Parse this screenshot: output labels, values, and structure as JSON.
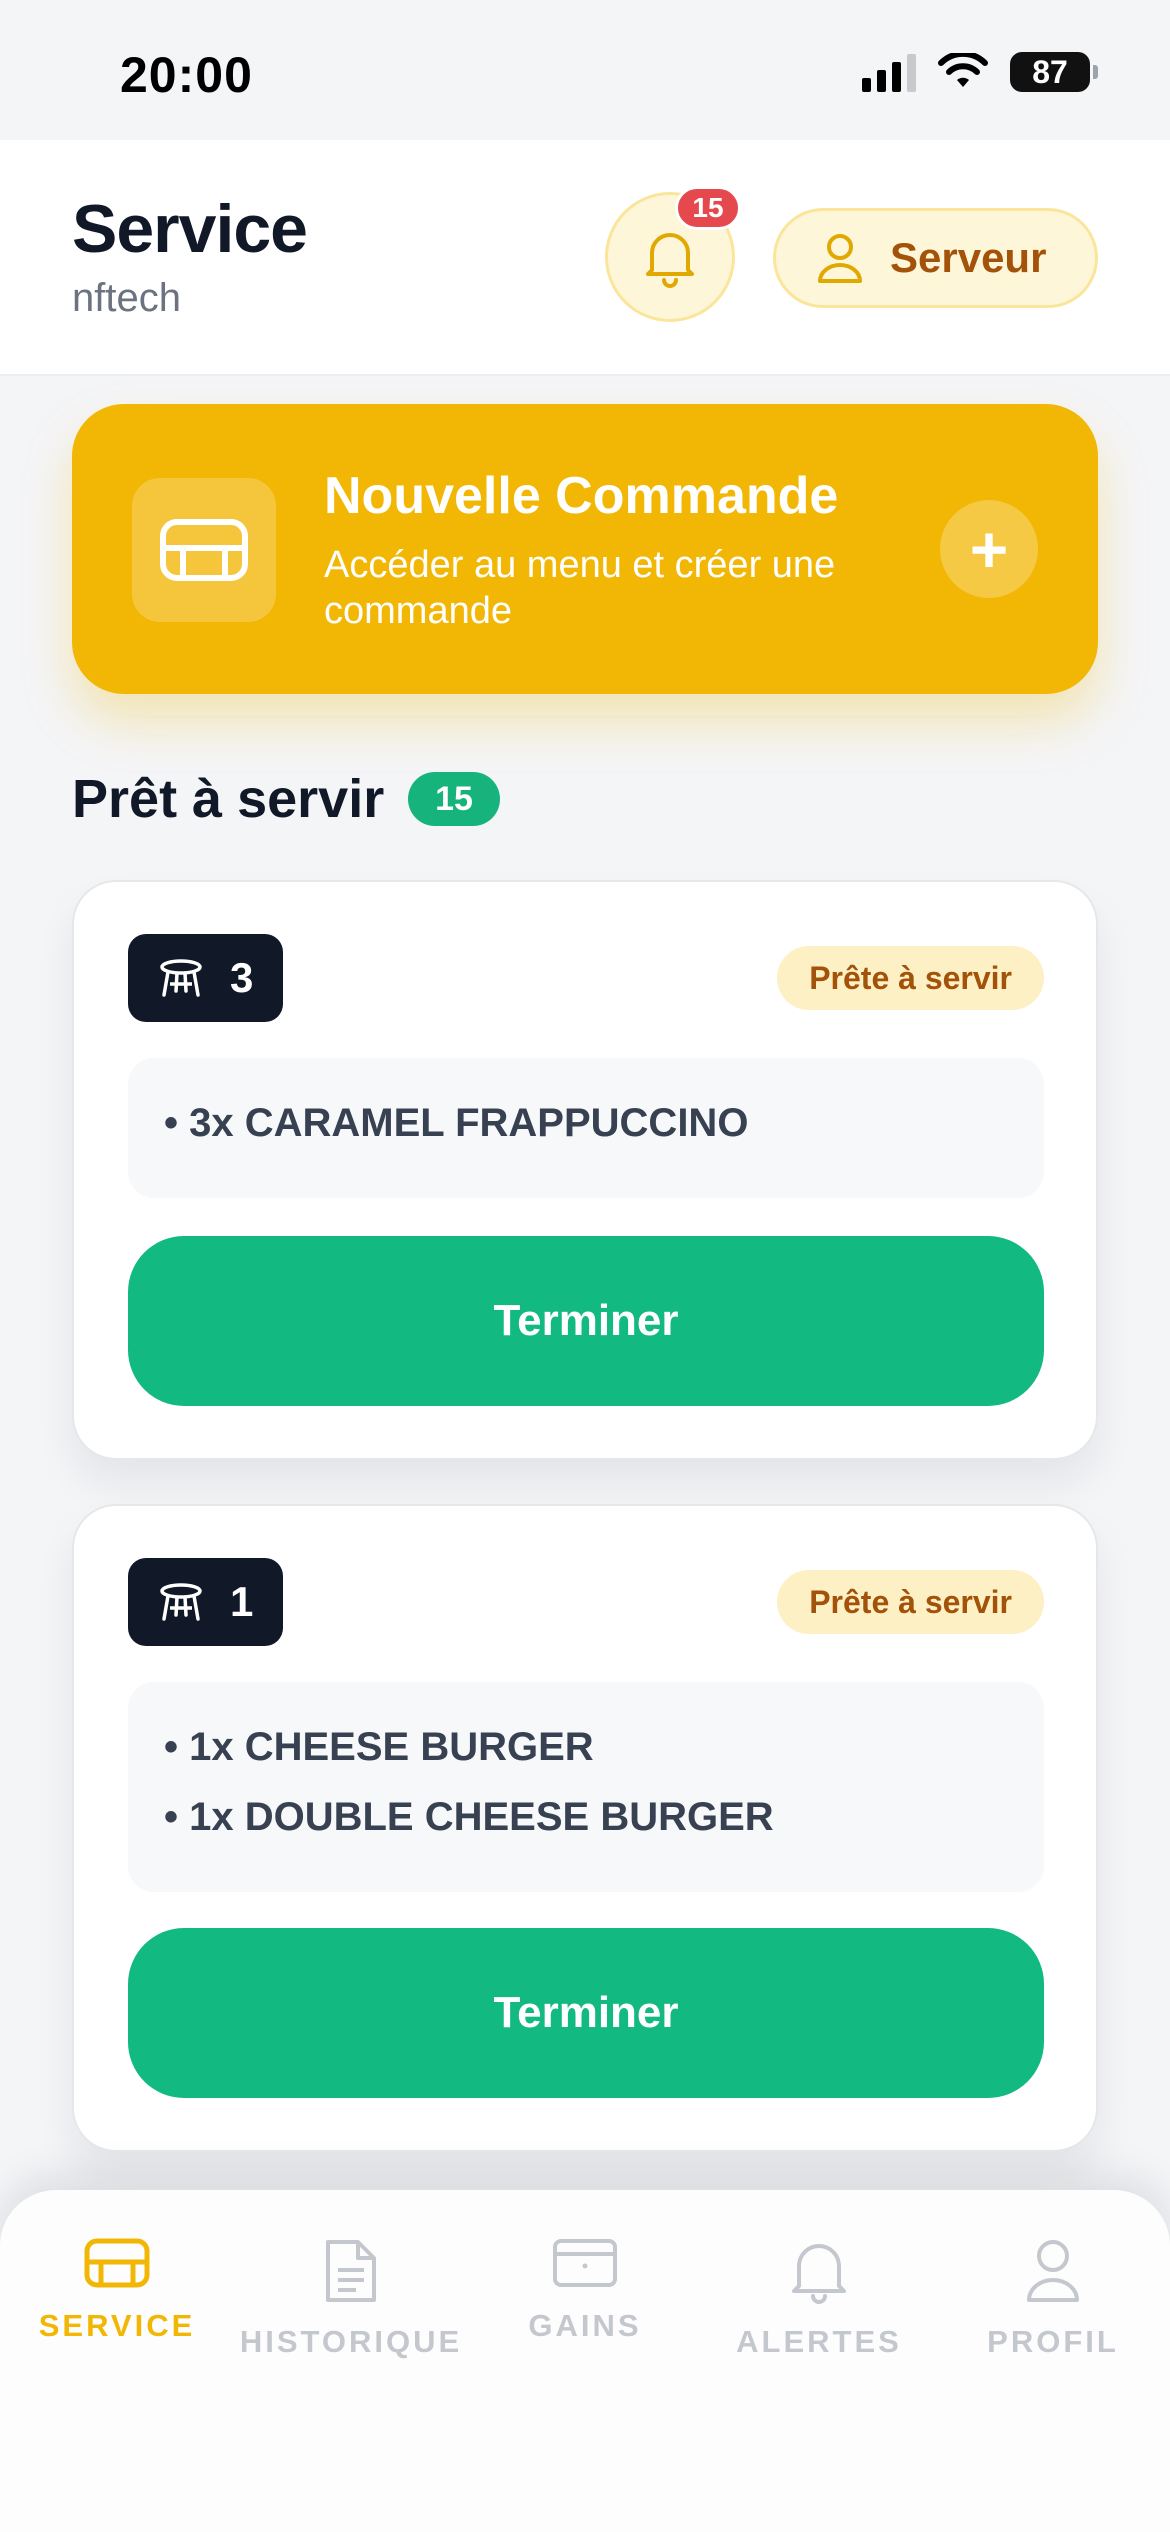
{
  "status_bar": {
    "time": "20:00",
    "battery": "87"
  },
  "header": {
    "title": "Service",
    "subtitle": "nftech",
    "notification_count": "15",
    "role_label": "Serveur"
  },
  "banner": {
    "title": "Nouvelle Commande",
    "subtitle": "Accéder au menu et créer une commande",
    "plus": "+"
  },
  "section": {
    "title": "Prêt à servir",
    "count": "15"
  },
  "orders": [
    {
      "table": "3",
      "status": "Prête à servir",
      "items": [
        "• 3x CARAMEL FRAPPUCCINO"
      ],
      "action": "Terminer"
    },
    {
      "table": "1",
      "status": "Prête à servir",
      "items": [
        "• 1x CHEESE BURGER",
        "• 1x DOUBLE CHEESE BURGER"
      ],
      "action": "Terminer"
    }
  ],
  "nav": {
    "items": [
      {
        "label": "SERVICE",
        "icon": "sofa-icon",
        "active": true
      },
      {
        "label": "HISTORIQUE",
        "icon": "document-icon",
        "active": false
      },
      {
        "label": "GAINS",
        "icon": "wallet-icon",
        "active": false
      },
      {
        "label": "ALERTES",
        "icon": "bell-icon",
        "active": false
      },
      {
        "label": "PROFIL",
        "icon": "user-icon",
        "active": false
      }
    ]
  },
  "colors": {
    "accent": "#f2b705",
    "success": "#12b981",
    "dark": "#111827",
    "badge_red": "#e5484d"
  }
}
